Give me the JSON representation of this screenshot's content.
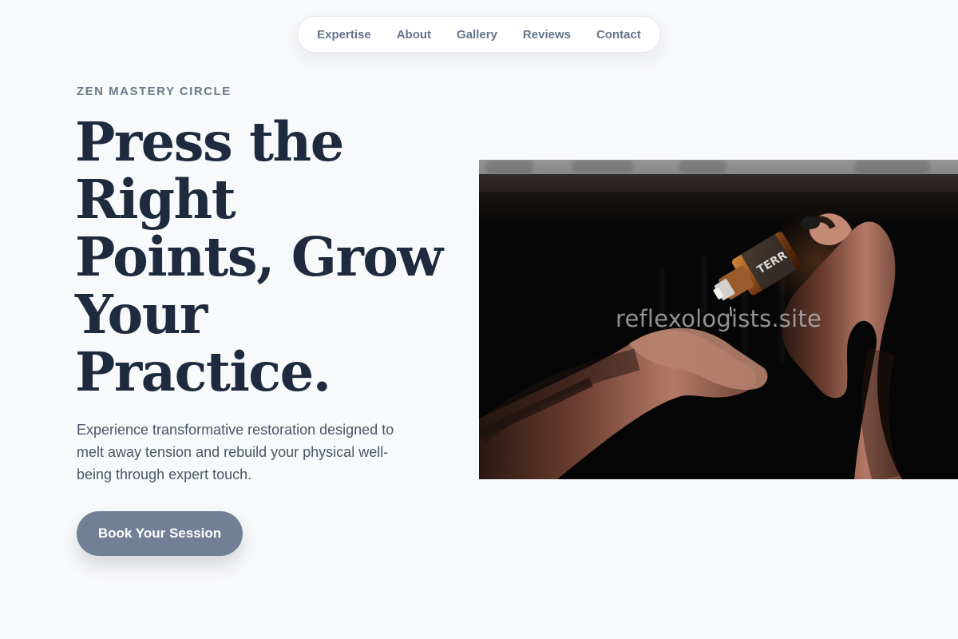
{
  "nav": {
    "items": [
      {
        "label": "Expertise"
      },
      {
        "label": "About"
      },
      {
        "label": "Gallery"
      },
      {
        "label": "Reviews"
      },
      {
        "label": "Contact"
      }
    ]
  },
  "hero": {
    "eyebrow": "ZEN MASTERY CIRCLE",
    "headline": "Press the Right Points, Grow Your Practice.",
    "description": "Experience transformative restoration designed to melt away tension and rebuild your physical well-being through expert touch.",
    "cta_label": "Book Your Session",
    "image_watermark": "reflexologists.site"
  },
  "colors": {
    "page_background": "#f8f9fb",
    "heading": "#1e2a3d",
    "body_text": "#4b5666",
    "nav_text": "#64748b",
    "button_background": "#718096",
    "button_text": "#ffffff"
  },
  "icons": [
    "essential-oil-bottle-photo",
    "hands-photo"
  ]
}
